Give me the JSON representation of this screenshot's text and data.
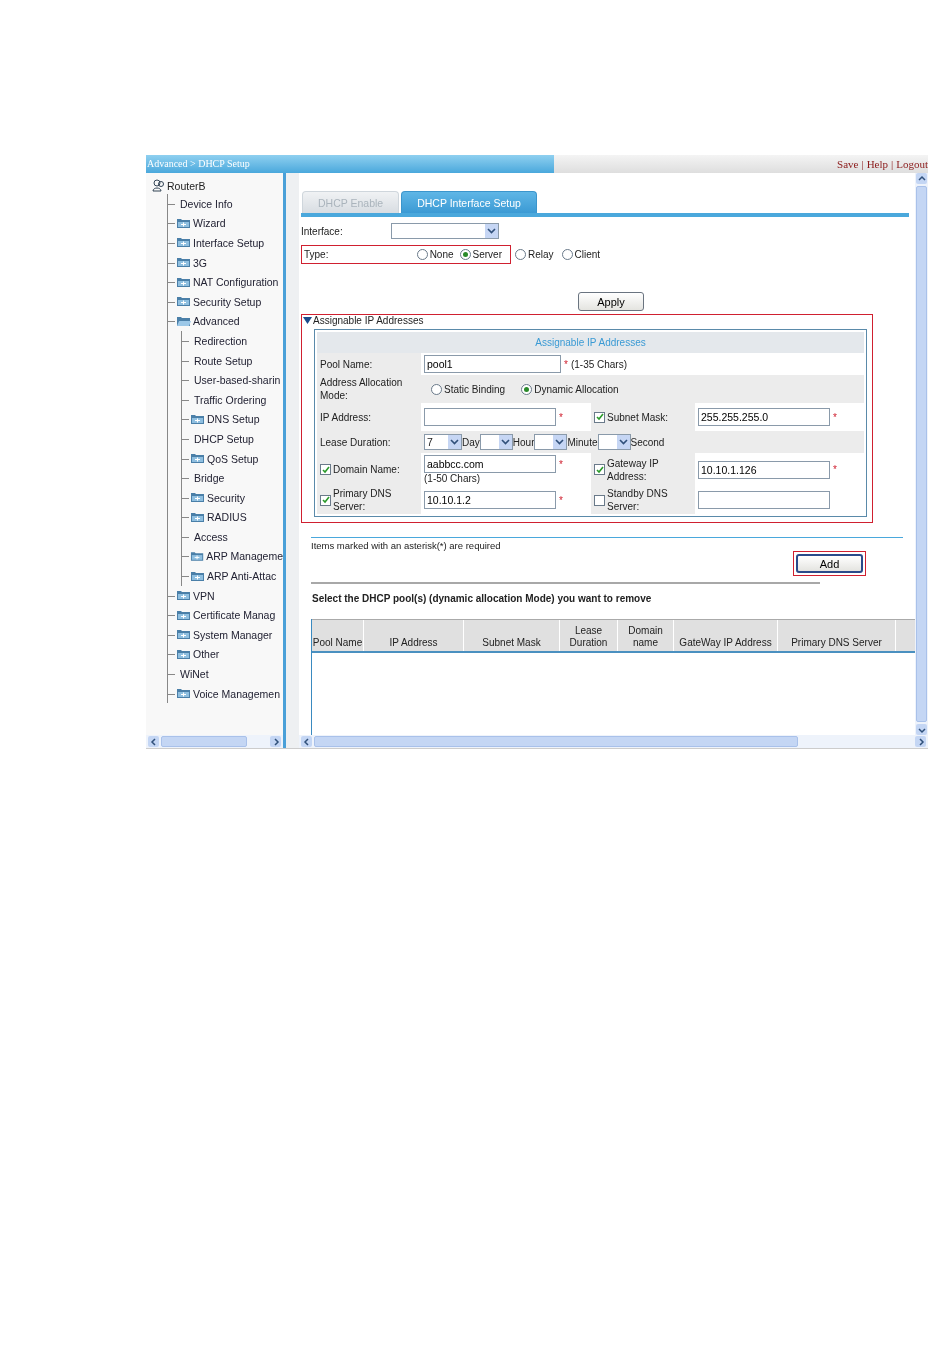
{
  "breadcrumb": "Advanced > DHCP Setup",
  "top_links": {
    "separator": "|",
    "items": [
      "Save",
      "Help",
      "Logout"
    ]
  },
  "sidebar": {
    "root": "RouterB",
    "items": [
      {
        "kind": "page",
        "label": "Device Info"
      },
      {
        "kind": "folder",
        "label": "Wizard",
        "expanded": false
      },
      {
        "kind": "folder",
        "label": "Interface Setup",
        "expanded": false
      },
      {
        "kind": "folder",
        "label": "3G",
        "expanded": false
      },
      {
        "kind": "folder",
        "label": "NAT Configuration",
        "expanded": false
      },
      {
        "kind": "folder",
        "label": "Security Setup",
        "expanded": false
      },
      {
        "kind": "folder",
        "label": "Advanced",
        "expanded": true,
        "children": [
          {
            "kind": "page",
            "label": "Redirection"
          },
          {
            "kind": "page",
            "label": "Route Setup"
          },
          {
            "kind": "page",
            "label": "User-based-sharin"
          },
          {
            "kind": "page",
            "label": "Traffic Ordering"
          },
          {
            "kind": "folder",
            "label": "DNS Setup",
            "expanded": false
          },
          {
            "kind": "page",
            "label": "DHCP Setup"
          },
          {
            "kind": "folder",
            "label": "QoS Setup",
            "expanded": false
          },
          {
            "kind": "page",
            "label": "Bridge"
          },
          {
            "kind": "folder",
            "label": "Security",
            "expanded": false
          },
          {
            "kind": "folder",
            "label": "RADIUS",
            "expanded": false
          },
          {
            "kind": "page",
            "label": "Access"
          },
          {
            "kind": "folder",
            "label": "ARP Manageme",
            "expanded": false
          },
          {
            "kind": "folder",
            "label": "ARP Anti-Attac",
            "expanded": false
          }
        ]
      },
      {
        "kind": "folder",
        "label": "VPN",
        "expanded": false
      },
      {
        "kind": "folder",
        "label": "Certificate Manag",
        "expanded": false
      },
      {
        "kind": "folder",
        "label": "System Manager",
        "expanded": false
      },
      {
        "kind": "folder",
        "label": "Other",
        "expanded": false
      },
      {
        "kind": "page",
        "label": "WiNet"
      },
      {
        "kind": "folder",
        "label": "Voice Managemen",
        "expanded": false
      }
    ]
  },
  "tabs": [
    {
      "label": "DHCP Enable",
      "selected": false
    },
    {
      "label": "DHCP Interface Setup",
      "selected": true
    }
  ],
  "interface": {
    "label": "Interface:"
  },
  "type": {
    "label": "Type:",
    "highlighted": true,
    "options": [
      {
        "label": "None",
        "selected": false
      },
      {
        "label": "Server",
        "selected": true
      },
      {
        "label": "Relay",
        "selected": false
      },
      {
        "label": "Client",
        "selected": false
      }
    ]
  },
  "apply_button": "Apply",
  "section": {
    "toggle": "Assignable IP Addresses",
    "expanded": true,
    "highlighted": true,
    "title": "Assignable IP Addresses",
    "rows": [
      {
        "kind": "input",
        "label": "Pool Name:",
        "value": "pool1",
        "mark": "*",
        "hint": "(1-35 Chars)"
      },
      {
        "kind": "radio",
        "label": "Address Allocation Mode:",
        "options": [
          {
            "label": "Static Binding",
            "selected": false
          },
          {
            "label": "Dynamic Allocation",
            "selected": true
          }
        ]
      },
      {
        "kind": "pair",
        "fields": [
          {
            "label": "IP Address:",
            "mark": "*"
          },
          {
            "label": "Subnet Mask:",
            "checked": true,
            "value": "255.255.255.0",
            "mark": "*"
          }
        ]
      },
      {
        "kind": "duration",
        "label": "Lease Duration:",
        "units": [
          {
            "value": "7",
            "unit": "Day"
          },
          {
            "unit": "Hour"
          },
          {
            "unit": "Minute"
          },
          {
            "unit": "Second"
          }
        ]
      },
      {
        "kind": "pair",
        "fields": [
          {
            "label": "Domain Name:",
            "checked": true,
            "value": "aabbcc.com",
            "mark": "*",
            "hint": "(1-50 Chars)"
          },
          {
            "label": "Gateway IP Address:",
            "checked": true,
            "value": "10.10.1.126",
            "mark": "*"
          }
        ]
      },
      {
        "kind": "pair",
        "fields": [
          {
            "label": "Primary DNS Server:",
            "checked": true,
            "value": "10.10.1.2",
            "mark": "*"
          },
          {
            "label": "Standby DNS Server:",
            "checked": false
          }
        ]
      }
    ]
  },
  "note": "Items marked with an asterisk(*) are required",
  "add_button": {
    "label": "Add",
    "highlighted": true
  },
  "remove_heading": "Select the DHCP pool(s) (dynamic allocation Mode) you want to remove",
  "pool_table": {
    "columns": [
      "Pool Name",
      "IP Address",
      "Subnet Mask",
      "Lease Duration",
      "Domain name",
      "GateWay IP Address",
      "Primary DNS Server"
    ]
  }
}
